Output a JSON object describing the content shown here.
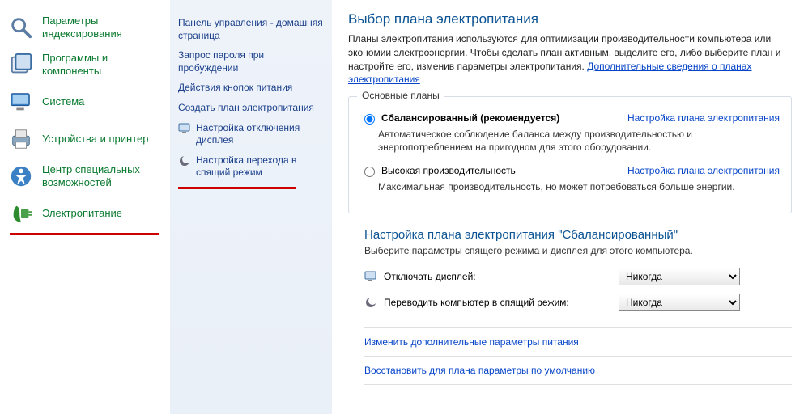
{
  "left_nav": {
    "items": [
      {
        "label": "Параметры индексирования"
      },
      {
        "label": "Программы и компоненты"
      },
      {
        "label": "Система"
      },
      {
        "label": "Устройства и принтер"
      },
      {
        "label": "Центр специальных возможностей"
      },
      {
        "label": "Электропитание"
      }
    ]
  },
  "mid_nav": {
    "items": [
      {
        "label": "Панель управления - домашняя страница"
      },
      {
        "label": "Запрос пароля при пробуждении"
      },
      {
        "label": "Действия кнопок питания"
      },
      {
        "label": "Создать план электропитания"
      },
      {
        "label": "Настройка отключения дисплея"
      },
      {
        "label": "Настройка перехода в спящий режим"
      }
    ]
  },
  "main": {
    "title": "Выбор плана электропитания",
    "description": "Планы электропитания используются для оптимизации производительности компьютера или экономии электроэнергии. Чтобы сделать план активным, выделите его, либо выберите план и настройте его, изменив параметры электропитания. ",
    "more_link": "Дополнительные сведения о планах электропитания",
    "group_title": "Основные планы",
    "plans": [
      {
        "name": "Сбалансированный (рекомендуется)",
        "desc": "Автоматическое соблюдение баланса между производительностью и энергопотреблением на пригодном для этого оборудовании.",
        "change_link": "Настройка плана электропитания",
        "checked": true
      },
      {
        "name": "Высокая производительность",
        "desc": "Максимальная производительность, но может потребоваться больше энергии.",
        "change_link": "Настройка плана электропитания",
        "checked": false
      }
    ],
    "sub_heading": "Настройка плана электропитания \"Сбалансированный\"",
    "sub_desc": "Выберите параметры спящего режима и дисплея для этого компьютера.",
    "settings": [
      {
        "label": "Отключать дисплей:",
        "value": "Никогда"
      },
      {
        "label": "Переводить компьютер в спящий режим:",
        "value": "Никогда"
      }
    ],
    "bottom_links": [
      "Изменить дополнительные параметры питания",
      "Восстановить для плана параметры по умолчанию"
    ]
  }
}
